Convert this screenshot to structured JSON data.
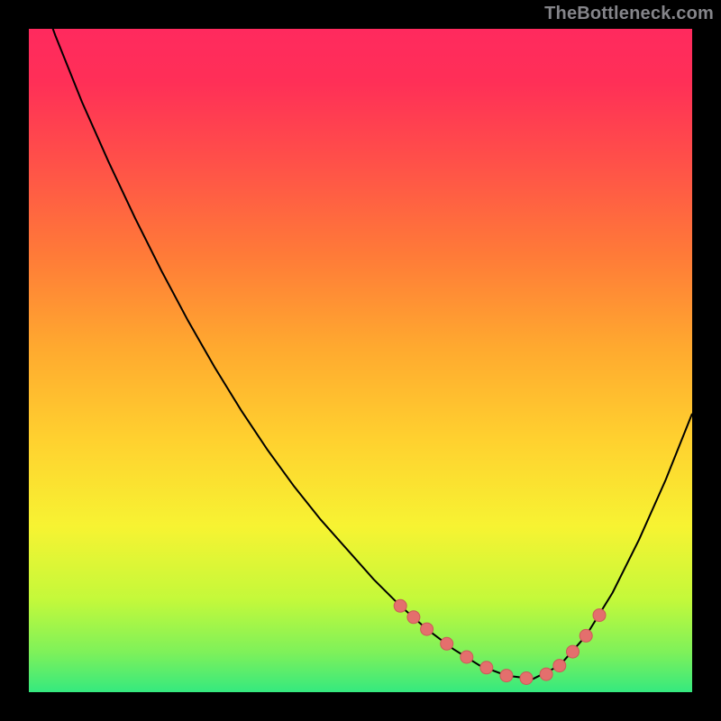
{
  "watermark": "TheBottleneck.com",
  "colors": {
    "background": "#000000",
    "curve": "#000000",
    "marker_fill": "#e46f6d",
    "marker_stroke": "#cd5a58",
    "gradient_top": "#ff2a5e",
    "gradient_bottom": "#35e97f"
  },
  "chart_data": {
    "type": "line",
    "title": "",
    "xlabel": "",
    "ylabel": "",
    "xlim": [
      0,
      100
    ],
    "ylim": [
      0,
      100
    ],
    "x": [
      0,
      4,
      8,
      12,
      16,
      20,
      24,
      28,
      32,
      36,
      40,
      44,
      48,
      52,
      56,
      60,
      64,
      68,
      72,
      76,
      80,
      84,
      88,
      92,
      96,
      100
    ],
    "values": [
      110,
      99,
      89,
      80,
      71.5,
      63.5,
      56,
      49,
      42.5,
      36.5,
      31,
      26,
      21.5,
      17,
      13,
      9.5,
      6.5,
      4,
      2.5,
      2,
      4,
      8.5,
      15,
      23,
      32,
      42
    ],
    "series": [
      {
        "name": "bottleneck-curve",
        "x": [
          0,
          4,
          8,
          12,
          16,
          20,
          24,
          28,
          32,
          36,
          40,
          44,
          48,
          52,
          56,
          60,
          64,
          68,
          72,
          76,
          80,
          84,
          88,
          92,
          96,
          100
        ],
        "y": [
          110,
          99,
          89,
          80,
          71.5,
          63.5,
          56,
          49,
          42.5,
          36.5,
          31,
          26,
          21.5,
          17,
          13,
          9.5,
          6.5,
          4,
          2.5,
          2,
          4,
          8.5,
          15,
          23,
          32,
          42
        ]
      },
      {
        "name": "highlight-points",
        "x": [
          56,
          58,
          60,
          63,
          66,
          69,
          72,
          75,
          78,
          80,
          82,
          84,
          86
        ],
        "y": [
          13,
          11.3,
          9.5,
          7.3,
          5.3,
          3.7,
          2.5,
          2.1,
          2.7,
          4,
          6.1,
          8.5,
          11.6
        ]
      }
    ]
  }
}
